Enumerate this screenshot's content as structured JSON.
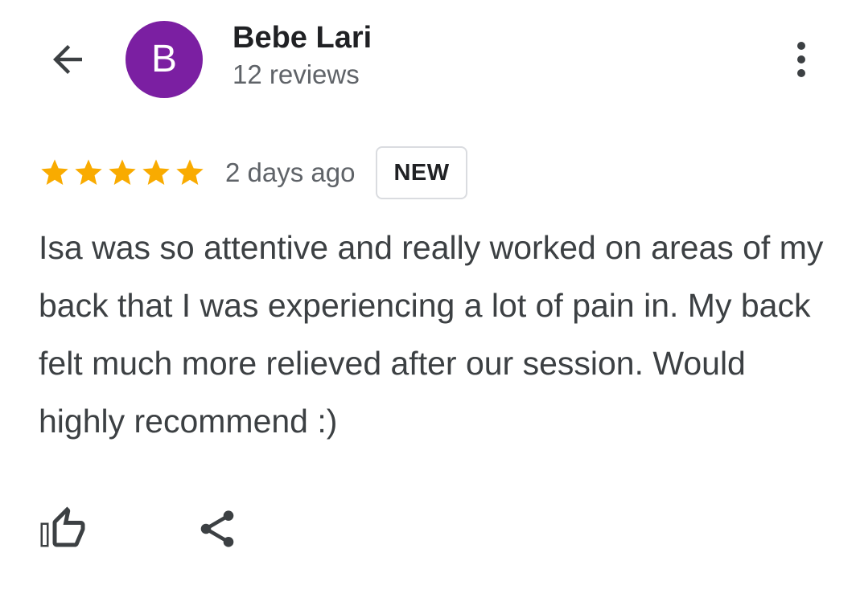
{
  "header": {
    "back_icon": "arrow-left-icon",
    "avatar_letter": "B",
    "avatar_color": "#7b1fa2",
    "reviewer_name": "Bebe Lari",
    "review_count": "12 reviews",
    "more_icon": "more-vertical-icon"
  },
  "review": {
    "rating": 5,
    "max_rating": 5,
    "star_color": "#f9ab00",
    "time_ago": "2 days ago",
    "badge": "NEW",
    "text": "Isa was so attentive and really worked on areas of my back that I was experiencing a lot of pain in. My back felt much more relieved after our session. Would highly recommend :)"
  },
  "actions": {
    "like_icon": "thumbs-up-icon",
    "share_icon": "share-icon"
  }
}
